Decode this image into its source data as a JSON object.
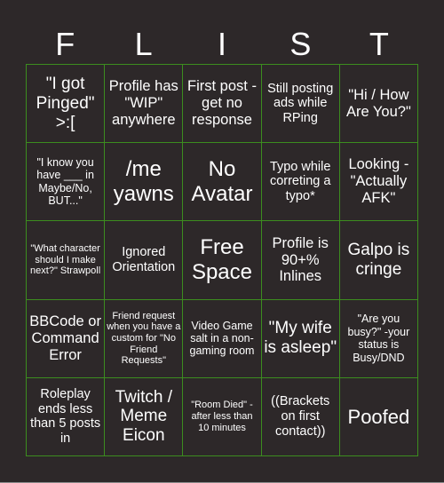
{
  "title_letters": [
    "F",
    "L",
    "I",
    "S",
    "T"
  ],
  "colors": {
    "background": "#2d2829",
    "grid_lines": "#3c8d1f",
    "text": "#ffffff"
  },
  "cells": [
    [
      "\"I got Pinged\" >:[",
      "Profile has \"WIP\" anywhere",
      "First post - get no response",
      "Still posting ads while RPing",
      "\"Hi / How Are You?\""
    ],
    [
      "\"I know you have ___ in Maybe/No, BUT...\"",
      "/me yawns",
      "No Avatar",
      "Typo while correting a typo*",
      "Looking - \"Actually AFK\""
    ],
    [
      "\"What character should I make next?\" Strawpoll",
      "Ignored Orientation",
      "Free Space",
      "Profile is 90+% Inlines",
      "Galpo is cringe"
    ],
    [
      "BBCode or Command Error",
      "Friend request when you have a custom for \"No Friend Requests\"",
      "Video Game salt in a non-gaming room",
      "\"My wife is asleep\"",
      "\"Are you busy?\" -your status is Busy/DND"
    ],
    [
      "Roleplay ends less than 5 posts in",
      "Twitch / Meme Eicon",
      "\"Room Died\" - after less than 10 minutes",
      "((Brackets on first contact))",
      "Poofed"
    ]
  ]
}
